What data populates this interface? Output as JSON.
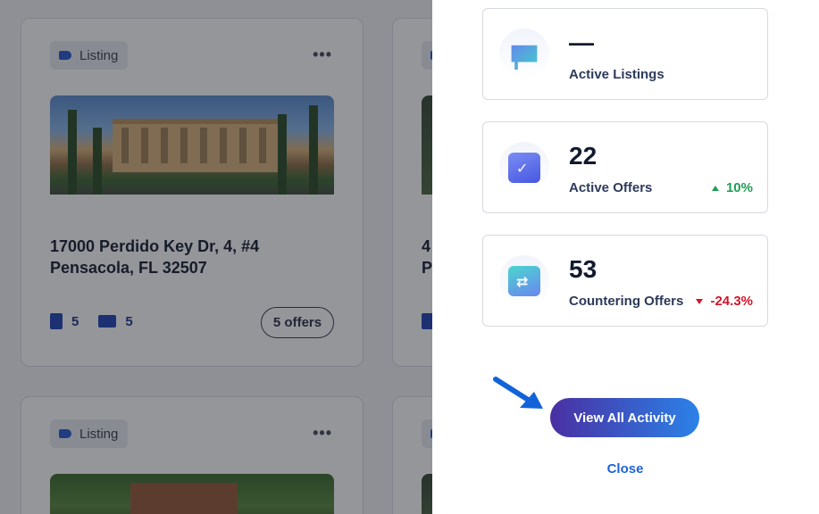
{
  "background": {
    "cards": [
      {
        "tag": "Listing",
        "address_line1": "17000 Perdido Key Dr, 4, #4",
        "address_line2": "Pensacola, FL 32507",
        "docs_count": "5",
        "messages_count": "5",
        "offers_label": "5 offers"
      },
      {
        "address_line1": "4",
        "address_line2": "P"
      },
      {
        "tag": "Listing"
      },
      {}
    ],
    "more_label": "•••"
  },
  "drawer": {
    "stats": [
      {
        "value": "—",
        "label": "Active Listings",
        "icon": "listing-sign-icon"
      },
      {
        "value": "22",
        "label": "Active Offers",
        "change": "10%",
        "direction": "up",
        "icon": "offer-document-icon"
      },
      {
        "value": "53",
        "label": "Countering Offers",
        "change": "-24.3%",
        "direction": "down",
        "icon": "counter-offer-icon"
      }
    ],
    "view_all_label": "View All Activity",
    "close_label": "Close"
  },
  "colors": {
    "accent_start": "#4a2fa2",
    "accent_end": "#2b82e8",
    "positive": "#1f9d55",
    "negative": "#d1152b",
    "link": "#1d63d6"
  }
}
